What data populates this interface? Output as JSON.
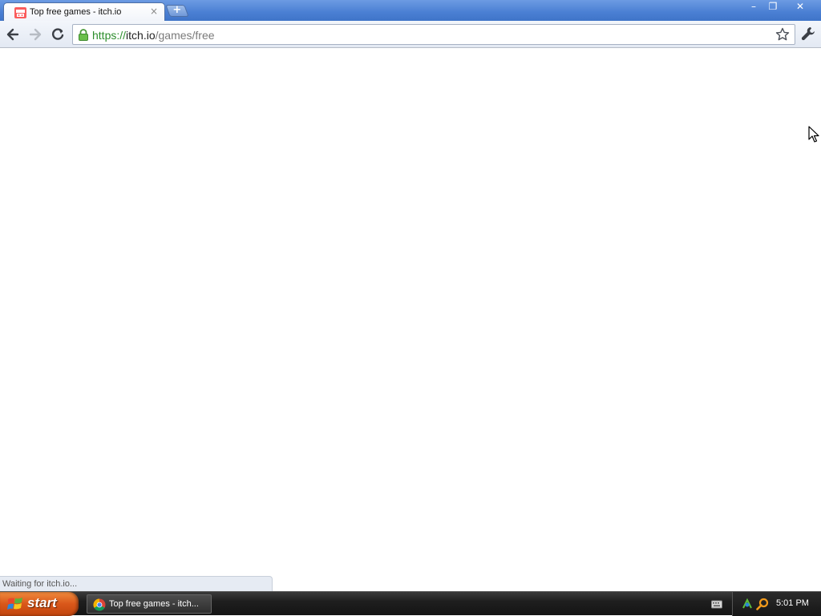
{
  "browser": {
    "tab_title": "Top free games - itch.io",
    "tab_close": "×",
    "new_tab": "+",
    "url": {
      "scheme": "https://",
      "host": "itch.io",
      "path": "/games/free"
    },
    "icons": [
      "itchio-favicon",
      "back-arrow-icon",
      "forward-arrow-icon",
      "reload-icon",
      "lock-icon",
      "star-icon",
      "wrench-icon"
    ],
    "window_controls": {
      "minimize": "–",
      "maximize": "❐",
      "close": "✕"
    },
    "status_text": "Waiting for itch.io..."
  },
  "taskbar": {
    "start_label": "start",
    "task_label": "Top free games - itch...",
    "clock": "5:01 PM"
  },
  "colors": {
    "titlebar": "#4a7fd3",
    "secure_scheme": "#2c8d2c",
    "start_button": "#d9571a"
  }
}
